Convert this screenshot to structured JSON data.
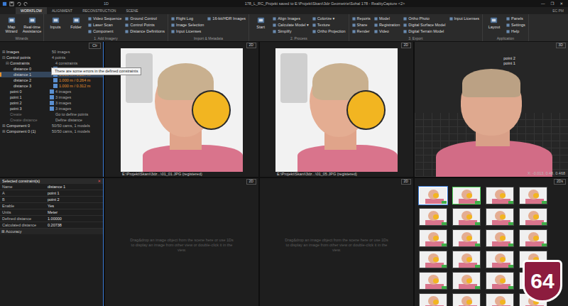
{
  "window": {
    "title": "178_L_RC_Projekt saved to E:\\Projekt\\Skani\\3dz Geometrie\\Sohal 178 - RealityCapture <2>",
    "tab": "1D",
    "corner": "EC PM",
    "controls": [
      "—",
      "❐",
      "✕"
    ]
  },
  "ribbon_tabs": [
    {
      "label": "WORKFLOW",
      "selected": true
    },
    {
      "label": "ALIGNMENT",
      "selected": false
    },
    {
      "label": "RECONSTRUCTION",
      "selected": false
    },
    {
      "label": "SCENE",
      "selected": false
    }
  ],
  "ribbon_groups": [
    {
      "title": "Wizards",
      "big": [
        "Map Wizard",
        "Real-time Assistance"
      ],
      "cols": []
    },
    {
      "title": "1. Add Imagery",
      "big": [
        "Inputs",
        "Folder"
      ],
      "cols": [
        [
          "Video Sequence",
          "Laser Scan",
          "Component"
        ],
        [
          "Ground Control",
          "Control Points",
          "Distance Definitions"
        ]
      ]
    },
    {
      "title": "Import & Metadata",
      "big": [],
      "cols": [
        [
          "Flight Log",
          "Image Selection",
          "Input Licenses"
        ],
        [
          "16-bit/HDR Images"
        ]
      ]
    },
    {
      "title": "2. Process",
      "big": [
        "Start"
      ],
      "cols": [
        [
          "Align Images",
          "Calculate Model ▾",
          "Simplify"
        ],
        [
          "Colorize ▾",
          "Texture",
          "Ortho Projection"
        ]
      ]
    },
    {
      "title": "3. Export",
      "big": [],
      "cols": [
        [
          "Reports",
          "Share",
          "Render"
        ],
        [
          "Model",
          "Registration",
          "Video"
        ],
        [
          "Ortho Photo",
          "Digital Surface Model",
          "Digital Terrain Model"
        ],
        [
          "Input Licenses"
        ]
      ]
    },
    {
      "title": "Application",
      "big": [
        "Layout"
      ],
      "cols": [
        [
          "Panels",
          "Settings",
          "Help"
        ]
      ]
    }
  ],
  "tree": {
    "button": "Clr",
    "tooltip": "There are some errors in the defined constraints",
    "items": [
      {
        "label": "Images",
        "value": "50 images",
        "depth": 0,
        "toggle": "⊞",
        "kind": "group",
        "checked": false,
        "selected": false,
        "error": false
      },
      {
        "label": "Control points",
        "value": "4 points",
        "depth": 0,
        "toggle": "⊟",
        "kind": "group",
        "checked": false,
        "selected": false,
        "error": false
      },
      {
        "label": "Constraints",
        "value": "4 constraints",
        "depth": 1,
        "toggle": "⊟",
        "kind": "group",
        "checked": false,
        "selected": false,
        "error": false
      },
      {
        "label": "distance 0",
        "value": "1.000 m / 0.191 m",
        "depth": 2,
        "toggle": "",
        "kind": "check",
        "checked": true,
        "selected": false,
        "error": true
      },
      {
        "label": "distance 1",
        "value": "1.000 m / 0.207 m",
        "depth": 2,
        "toggle": "",
        "kind": "check",
        "checked": true,
        "selected": true,
        "error": true
      },
      {
        "label": "distance 2",
        "value": "1.000 m / 0.264 m",
        "depth": 2,
        "toggle": "",
        "kind": "check",
        "checked": true,
        "selected": false,
        "error": true
      },
      {
        "label": "distance 3",
        "value": "1.000 m / 0.312 m",
        "depth": 2,
        "toggle": "",
        "kind": "check",
        "checked": true,
        "selected": false,
        "error": true
      },
      {
        "label": "point 0",
        "value": "4 images",
        "depth": 1,
        "toggle": "",
        "kind": "check",
        "checked": true,
        "selected": false,
        "error": false
      },
      {
        "label": "point 1",
        "value": "3 images",
        "depth": 1,
        "toggle": "",
        "kind": "check",
        "checked": true,
        "selected": false,
        "error": false
      },
      {
        "label": "point 2",
        "value": "3 images",
        "depth": 1,
        "toggle": "",
        "kind": "check",
        "checked": true,
        "selected": false,
        "error": false
      },
      {
        "label": "point 3",
        "value": "3 images",
        "depth": 1,
        "toggle": "",
        "kind": "check",
        "checked": true,
        "selected": false,
        "error": false
      },
      {
        "label": "Create",
        "value": "Go to define points",
        "depth": 1,
        "toggle": "",
        "kind": "action",
        "checked": false,
        "selected": false,
        "error": false
      },
      {
        "label": "Create distance",
        "value": "Define distance",
        "depth": 1,
        "toggle": "",
        "kind": "action",
        "checked": false,
        "selected": false,
        "error": false
      },
      {
        "label": "Component 0",
        "value": "50/50 cams, 1 models",
        "depth": 0,
        "toggle": "⊞",
        "kind": "group",
        "checked": false,
        "selected": false,
        "error": false
      },
      {
        "label": "Component 0 (1)",
        "value": "50/50 cams, 1 models",
        "depth": 0,
        "toggle": "⊞",
        "kind": "group",
        "checked": false,
        "selected": false,
        "error": false
      }
    ]
  },
  "properties": {
    "title": "Selected constraint(s)",
    "close": "✕",
    "rows": [
      {
        "key": "Name",
        "value": "distance 1"
      },
      {
        "key": "A",
        "value": "point 1"
      },
      {
        "key": "B",
        "value": "point 2"
      },
      {
        "key": "Enable",
        "value": "Yes"
      },
      {
        "key": "Units",
        "value": "Meter"
      },
      {
        "key": "Defined distance",
        "value": "1.00000"
      },
      {
        "key": "Calculated distance",
        "value": "0.20738"
      }
    ],
    "section": {
      "toggle": "⊞",
      "label": "Accuracy"
    }
  },
  "image_views": [
    {
      "label": "2D",
      "path": "E:\\Projekt\\Skani\\3dz...\\01_01.JPG (registered)"
    },
    {
      "label": "2D",
      "path": "E:\\Projekt\\Skani\\3dz...\\01_05.JPG (registered)"
    }
  ],
  "model_view": {
    "label": "3D",
    "markers": [
      "point 2",
      "point 1"
    ],
    "coords": "X: -0.013, 0.48, 0.468"
  },
  "empty_views": [
    {
      "label": "2D",
      "message": "Drag&drop an image object from the scene here or use 1Ds to display an image from other view or double-click it in the view."
    },
    {
      "label": "2D",
      "message": "Drag&drop an image object from the scene here or use 1Ds to display an image from other view or double-click it in the view."
    }
  ],
  "thumbnails": {
    "label": "2Ds",
    "items": [
      {
        "selected": true,
        "focused": false
      },
      {
        "selected": false,
        "focused": true
      },
      {
        "selected": false,
        "focused": false
      },
      {
        "selected": false,
        "focused": false
      },
      {
        "selected": false,
        "focused": false
      },
      {
        "selected": false,
        "focused": false
      },
      {
        "selected": false,
        "focused": false
      },
      {
        "selected": false,
        "focused": false
      },
      {
        "selected": false,
        "focused": false
      },
      {
        "selected": false,
        "focused": false
      },
      {
        "selected": false,
        "focused": false
      },
      {
        "selected": false,
        "focused": false
      },
      {
        "selected": false,
        "focused": false
      },
      {
        "selected": false,
        "focused": false
      },
      {
        "selected": false,
        "focused": false
      },
      {
        "selected": false,
        "focused": false
      },
      {
        "selected": false,
        "focused": false
      },
      {
        "selected": false,
        "focused": false
      },
      {
        "selected": false,
        "focused": false
      },
      {
        "selected": false,
        "focused": false
      },
      {
        "selected": false,
        "focused": false
      },
      {
        "selected": false,
        "focused": false
      },
      {
        "selected": false,
        "focused": false
      },
      {
        "selected": false,
        "focused": false
      }
    ]
  },
  "badge": "64"
}
